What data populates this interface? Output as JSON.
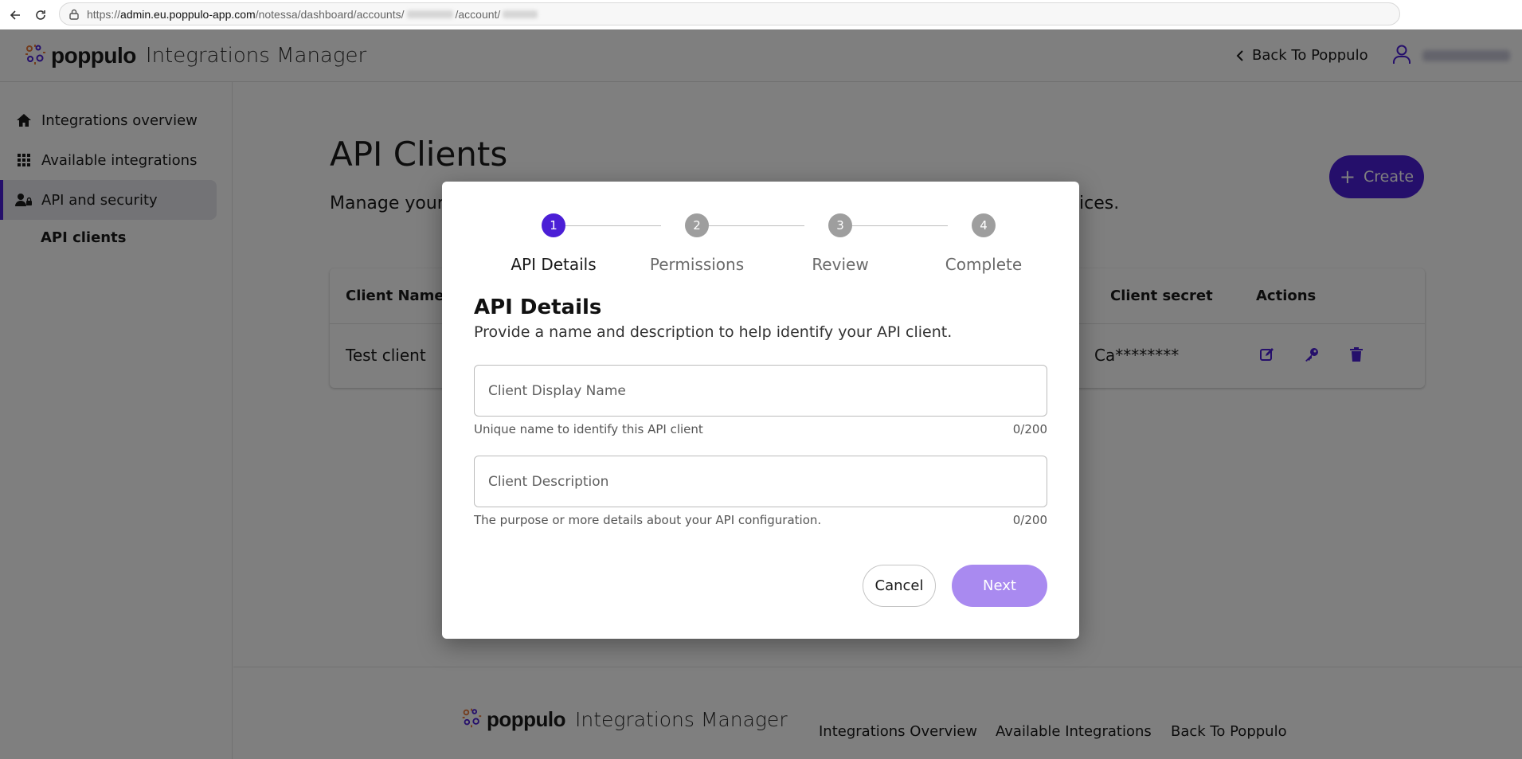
{
  "browser": {
    "url_prefix": "https://",
    "url_host": "admin.eu.poppulo-app.com",
    "url_path_1": "/notessa/dashboard/accounts/",
    "url_path_2": "/account/"
  },
  "header": {
    "logo_text": "poppulo",
    "product_name": "Integrations Manager",
    "back_link": "Back To Poppulo"
  },
  "sidebar": {
    "items": [
      {
        "label": "Integrations overview",
        "icon": "home-icon"
      },
      {
        "label": "Available integrations",
        "icon": "grid-icon"
      },
      {
        "label": "API and security",
        "icon": "user-lock-icon"
      }
    ],
    "sub_item": "API clients"
  },
  "main": {
    "title": "API Clients",
    "description_start": "Manage your",
    "description_end": "vices.",
    "create_label": "Create",
    "table": {
      "headers": {
        "client_name": "Client Name",
        "client_secret": "Client secret",
        "actions": "Actions"
      },
      "rows": [
        {
          "client_name": "Test client",
          "client_secret": "Ca********"
        }
      ]
    }
  },
  "footer": {
    "logo_text": "poppulo",
    "product_name": "Integrations Manager",
    "links": [
      "Integrations Overview",
      "Available Integrations",
      "Back To Poppulo"
    ]
  },
  "modal": {
    "steps": [
      {
        "number": "1",
        "label": "API Details",
        "active": true
      },
      {
        "number": "2",
        "label": "Permissions",
        "active": false
      },
      {
        "number": "3",
        "label": "Review",
        "active": false
      },
      {
        "number": "4",
        "label": "Complete",
        "active": false
      }
    ],
    "heading": "API Details",
    "subheading": "Provide a name and description to help identify your API client.",
    "name_field": {
      "placeholder": "Client Display Name",
      "helper": "Unique name to identify this API client",
      "counter": "0/200"
    },
    "description_field": {
      "placeholder": "Client Description",
      "helper": "The purpose or more details about your API configuration.",
      "counter": "0/200"
    },
    "cancel_label": "Cancel",
    "next_label": "Next"
  },
  "colors": {
    "accent": "#4b1fd6",
    "next_disabled": "#a98af0",
    "overlay": "rgba(0,0,0,0.5)"
  }
}
